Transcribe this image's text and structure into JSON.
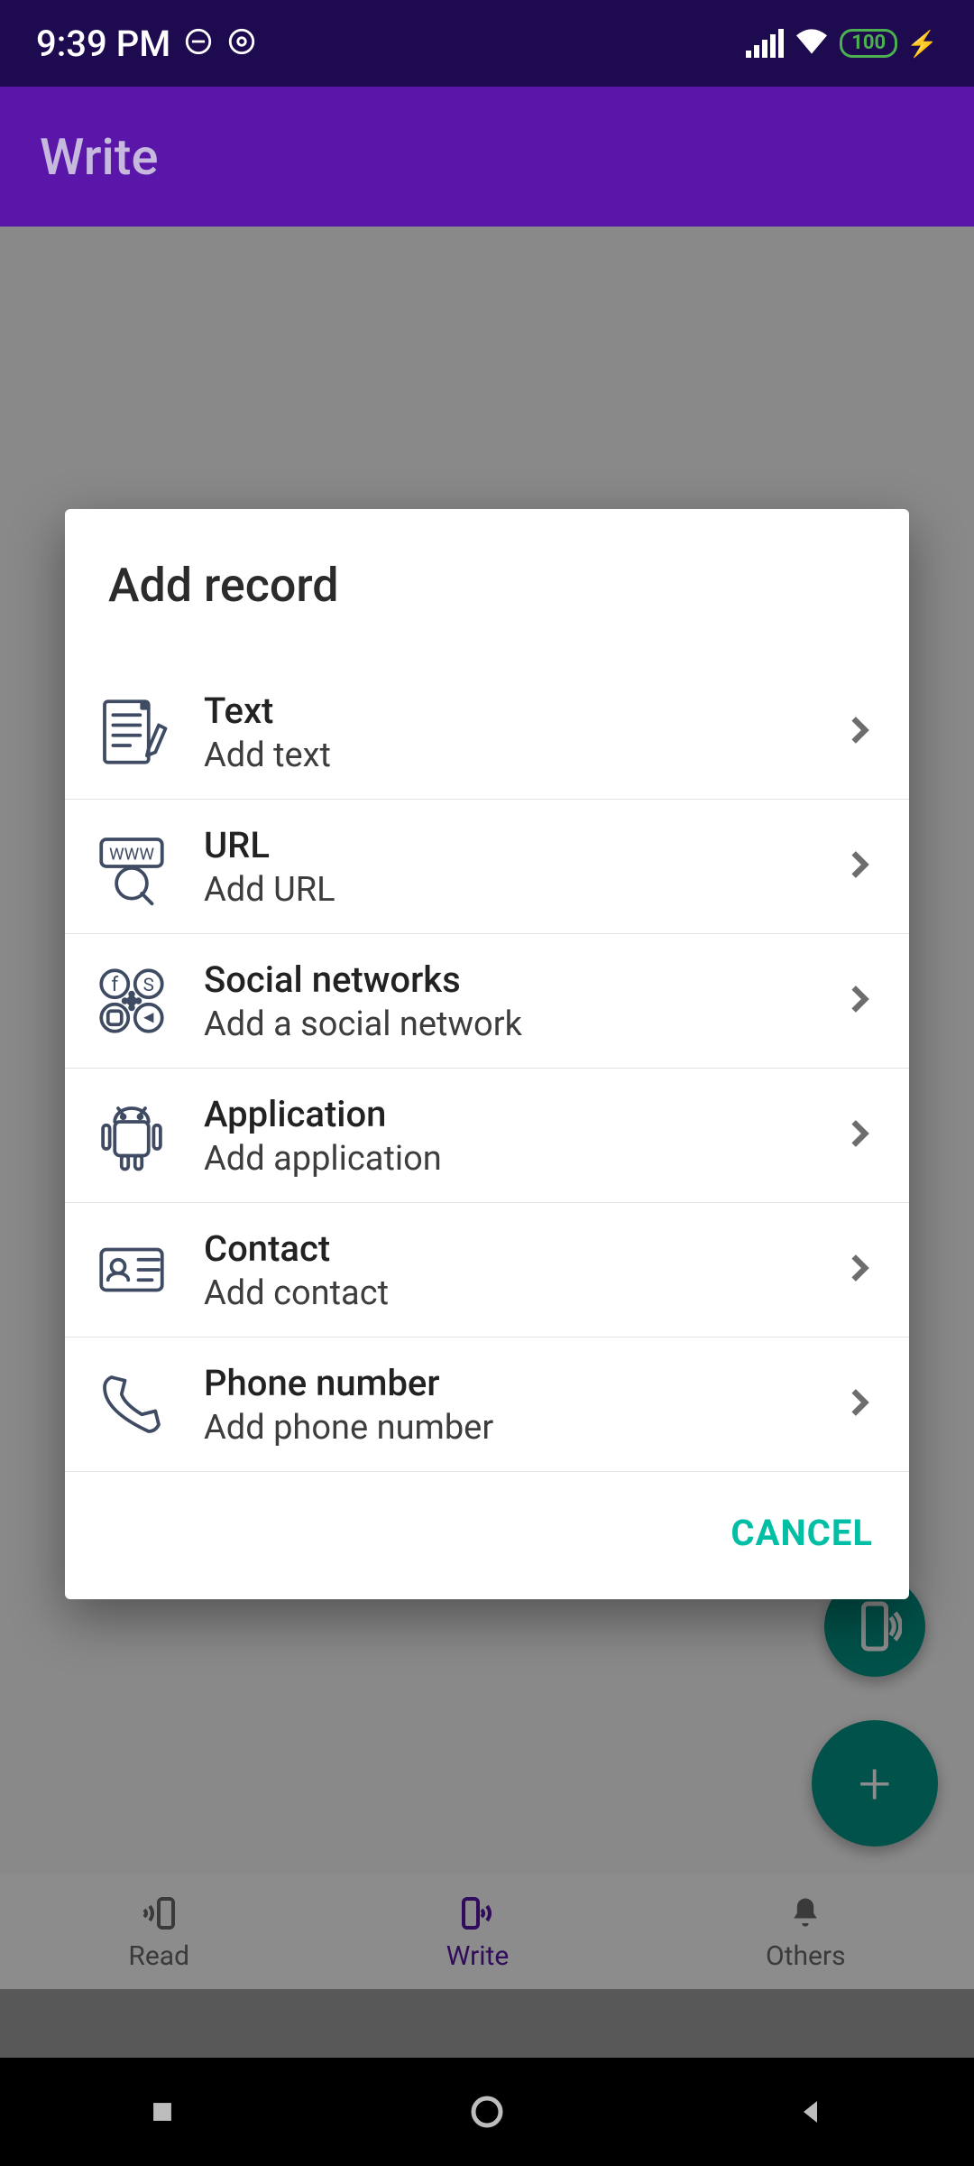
{
  "status": {
    "time": "9:39 PM",
    "battery": "100"
  },
  "app_bar": {
    "title": "Write"
  },
  "dialog": {
    "title": "Add record",
    "cancel": "CANCEL",
    "items": [
      {
        "title": "Text",
        "subtitle": "Add text"
      },
      {
        "title": "URL",
        "subtitle": "Add URL"
      },
      {
        "title": "Social networks",
        "subtitle": "Add a social network"
      },
      {
        "title": "Application",
        "subtitle": "Add application"
      },
      {
        "title": "Contact",
        "subtitle": "Add contact"
      },
      {
        "title": "Phone number",
        "subtitle": "Add phone number"
      }
    ]
  },
  "bottom_nav": {
    "read": "Read",
    "write": "Write",
    "others": "Others"
  }
}
